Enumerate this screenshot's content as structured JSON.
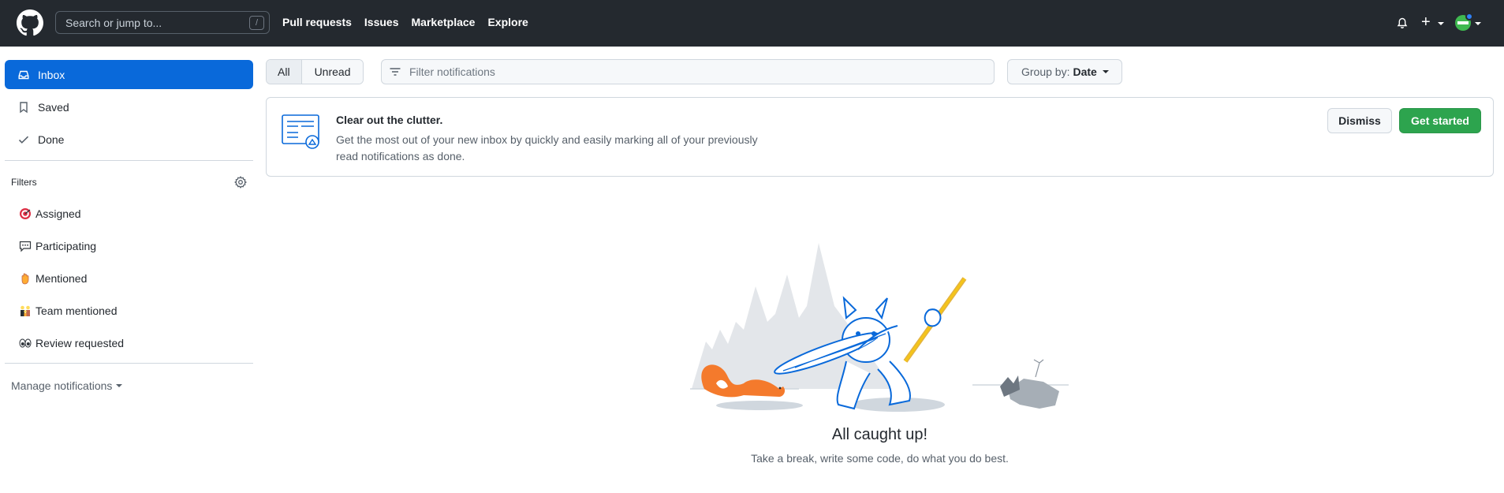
{
  "header": {
    "search_placeholder": "Search or jump to...",
    "search_shortcut": "/",
    "nav": [
      "Pull requests",
      "Issues",
      "Marketplace",
      "Explore"
    ],
    "plus_label": "+"
  },
  "sidebar": {
    "items": [
      {
        "label": "Inbox",
        "icon": "inbox-icon",
        "active": true
      },
      {
        "label": "Saved",
        "icon": "bookmark-icon"
      },
      {
        "label": "Done",
        "icon": "check-icon"
      }
    ],
    "filters_title": "Filters",
    "filters": [
      {
        "label": "Assigned",
        "icon": "dart-icon"
      },
      {
        "label": "Participating",
        "icon": "speech-bubble-icon"
      },
      {
        "label": "Mentioned",
        "icon": "raised-hand-icon"
      },
      {
        "label": "Team mentioned",
        "icon": "family-icon"
      },
      {
        "label": "Review requested",
        "icon": "eyes-icon"
      }
    ],
    "manage_label": "Manage notifications"
  },
  "toolbar": {
    "tab_all": "All",
    "tab_unread": "Unread",
    "filter_placeholder": "Filter notifications",
    "group_by_label": "Group by:",
    "group_by_value": "Date"
  },
  "banner": {
    "title": "Clear out the clutter.",
    "description": "Get the most out of your new inbox by quickly and easily marking all of your previously read notifications as done.",
    "dismiss_label": "Dismiss",
    "get_started_label": "Get started"
  },
  "empty_state": {
    "title": "All caught up!",
    "subtitle": "Take a break, write some code, do what you do best."
  },
  "colors": {
    "header_bg": "#24292f",
    "accent": "#0969da",
    "success": "#2da44e"
  }
}
